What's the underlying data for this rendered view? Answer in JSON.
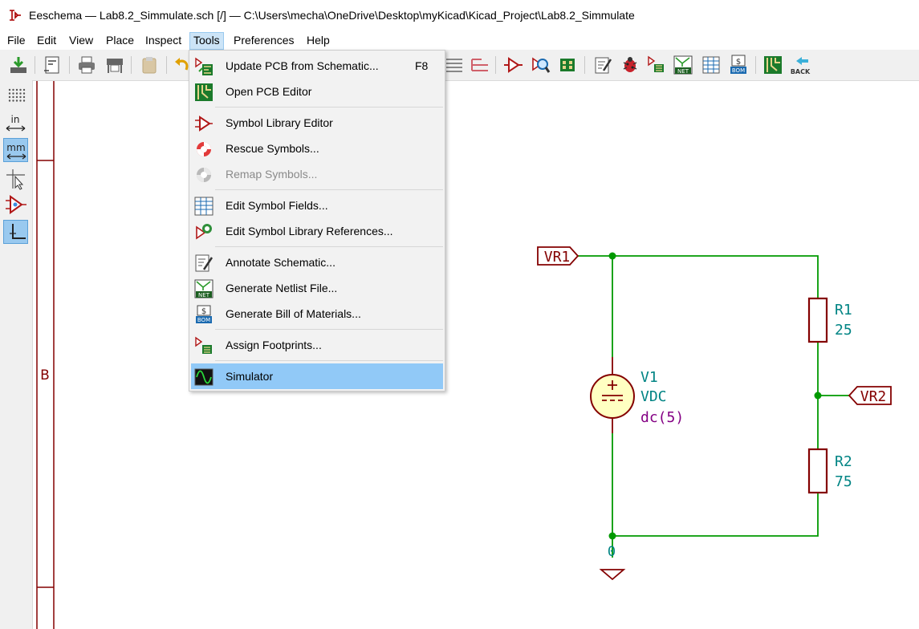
{
  "window": {
    "title": "Eeschema — Lab8.2_Simmulate.sch [/] — C:\\Users\\mecha\\OneDrive\\Desktop\\myKicad\\Kicad_Project\\Lab8.2_Simmulate",
    "app_icon": "eeschema-app-icon"
  },
  "menubar": {
    "items": [
      "File",
      "Edit",
      "View",
      "Place",
      "Inspect",
      "Tools",
      "Preferences",
      "Help"
    ],
    "active": "Tools"
  },
  "toolbar": {
    "icons": [
      "save-icon",
      "page-settings-icon",
      "print-icon",
      "plot-icon",
      "paste-icon",
      "undo-icon",
      "hierarchy-icon",
      "leave-sheet-icon",
      "symbol-editor-icon",
      "symbol-browser-icon",
      "footprint-icon",
      "annotate-icon",
      "erc-icon",
      "assign-footprints-icon",
      "netlist-icon",
      "edit-fields-icon",
      "bom-icon",
      "pcbnew-icon",
      "back-annotate-icon"
    ],
    "net_label": "NET",
    "bom_label": "BOM",
    "back_label": "BACK"
  },
  "left_toolbar": {
    "icons": [
      "grid-icon",
      "inch-units-icon",
      "mm-units-icon",
      "cursor-icon",
      "hidden-pins-icon",
      "line-mode-icon"
    ],
    "in_label": "in",
    "mm_label": "mm"
  },
  "tools_menu": {
    "items": [
      {
        "label": "Update PCB from Schematic...",
        "shortcut": "F8",
        "icon": "update-pcb-icon",
        "enabled": true
      },
      {
        "label": "Open PCB Editor",
        "icon": "pcb-editor-icon",
        "enabled": true
      },
      {
        "label": "Symbol Library Editor",
        "icon": "symbol-library-editor-icon",
        "enabled": true
      },
      {
        "label": "Rescue Symbols...",
        "icon": "rescue-icon",
        "enabled": true
      },
      {
        "label": "Remap Symbols...",
        "icon": "remap-icon",
        "enabled": false
      },
      {
        "label": "Edit Symbol Fields...",
        "icon": "symbol-fields-icon",
        "enabled": true
      },
      {
        "label": "Edit Symbol Library References...",
        "icon": "library-references-icon",
        "enabled": true
      },
      {
        "label": "Annotate Schematic...",
        "icon": "annotate-icon",
        "enabled": true
      },
      {
        "label": "Generate Netlist File...",
        "icon": "netlist-icon",
        "enabled": true
      },
      {
        "label": "Generate Bill of Materials...",
        "icon": "bom-icon",
        "enabled": true
      },
      {
        "label": "Assign Footprints...",
        "icon": "assign-footprints-icon",
        "enabled": true
      },
      {
        "label": "Simulator",
        "icon": "simulator-icon",
        "enabled": true,
        "highlighted": true
      }
    ],
    "net_label": "NET",
    "bom_label": "BOM"
  },
  "schematic": {
    "sheet_border_label": "B",
    "labels": {
      "vr1": "VR1",
      "vr2": "VR2"
    },
    "v1": {
      "ref": "V1",
      "value": "VDC",
      "spice": "dc(5)"
    },
    "r1": {
      "ref": "R1",
      "value": "25"
    },
    "r2": {
      "ref": "R2",
      "value": "75"
    },
    "ground_net": "0",
    "colors": {
      "wire": "#009900",
      "component": "#840000",
      "component_fill": "#ffffc2",
      "reference": "#008484",
      "spice": "#840084",
      "label": "#840000"
    }
  }
}
